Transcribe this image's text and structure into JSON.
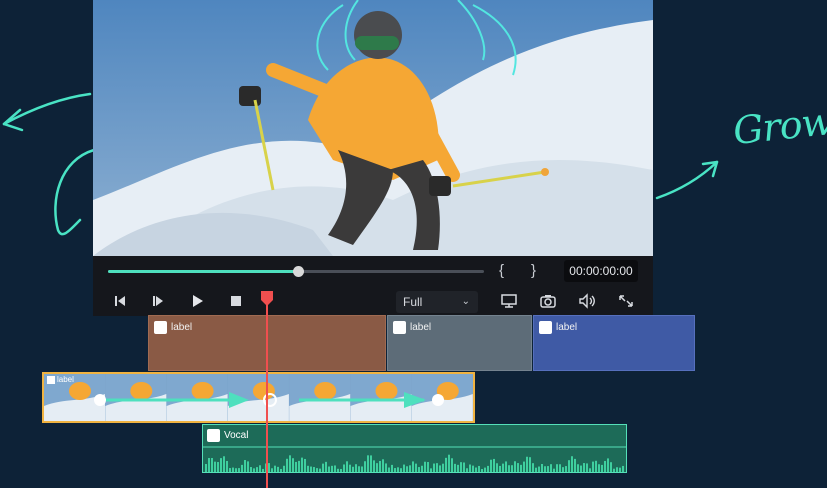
{
  "player": {
    "timecode": "00:00:00:00",
    "mark_in": "{",
    "mark_out": "}",
    "progress": 0.506,
    "zoom_select": "Full"
  },
  "decor": {
    "grow_text": "Grow"
  },
  "timeline": {
    "clips": [
      {
        "label": "label",
        "color": "#8a5a45"
      },
      {
        "label": "label",
        "color": "#5d6c78"
      },
      {
        "label": "label",
        "color": "#3f5aa5"
      }
    ],
    "video_clip": {
      "label": "label",
      "border_color": "#f0b341"
    },
    "audio_clip": {
      "label": "Vocal",
      "color": "#1d6b58"
    },
    "playhead_color": "#f04f4f"
  },
  "icons": {
    "prev_frame": "step-back-icon",
    "next_frame": "step-forward-icon",
    "play": "play-icon",
    "stop": "stop-icon",
    "display": "monitor-icon",
    "snapshot": "camera-icon",
    "volume": "speaker-icon",
    "fullscreen": "expand-icon"
  }
}
